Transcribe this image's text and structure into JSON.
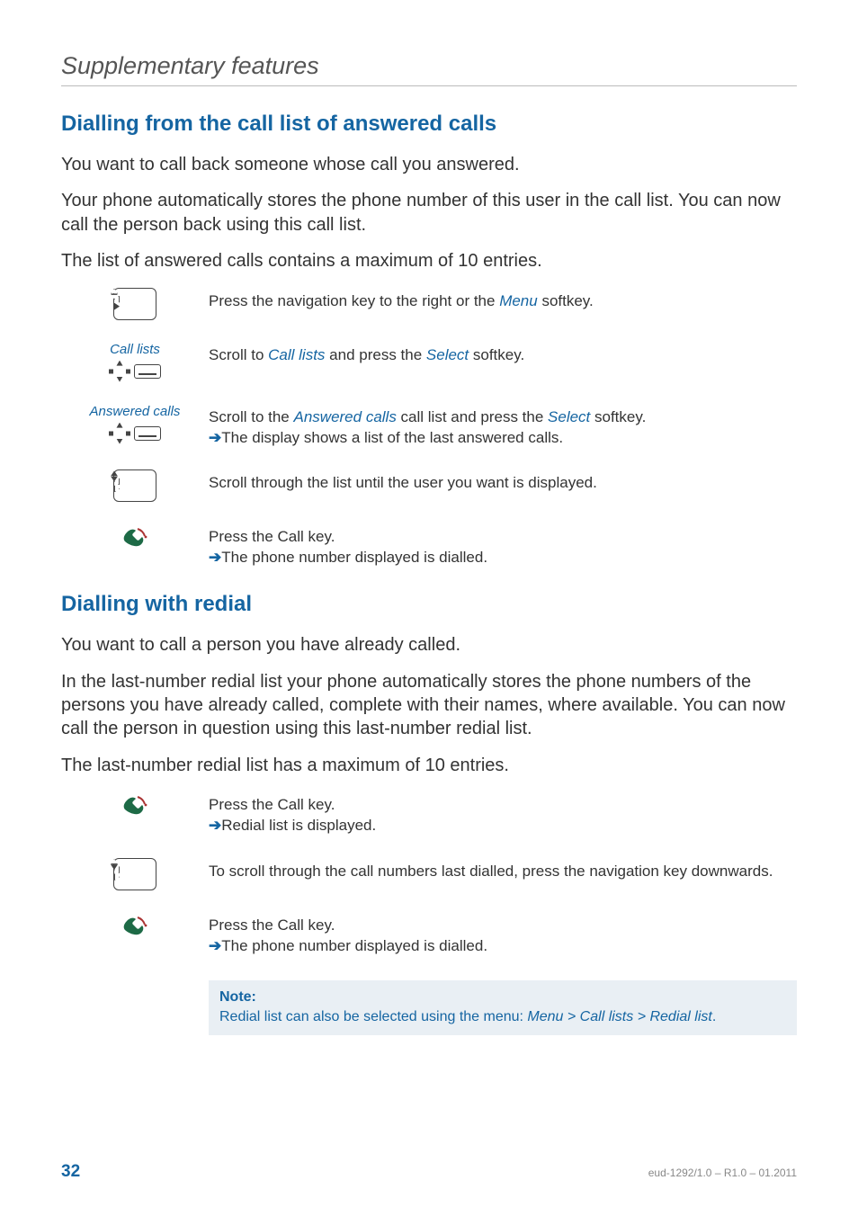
{
  "chapter_title": "Supplementary features",
  "section1": {
    "heading": "Dialling from the call list of answered calls",
    "p1": "You want to call back someone whose call you answered.",
    "p2": "Your phone automatically stores the phone number of this user in the call list. You can now call the person back using this call list.",
    "p3": "The list of answered calls contains a maximum of 10 entries.",
    "steps": [
      {
        "icon_label": "",
        "text_pre": "Press the navigation key to the right or the ",
        "term1": "Menu",
        "text_post": " softkey."
      },
      {
        "icon_label": "Call lists",
        "text_pre": "Scroll to ",
        "term1": "Call lists",
        "text_mid": " and press the ",
        "term2": "Select",
        "text_post": " softkey."
      },
      {
        "icon_label": "Answered calls",
        "text_pre": "Scroll to the ",
        "term1": "Answered calls",
        "text_mid": " call list and press the ",
        "term2": "Select",
        "text_post": " softkey.",
        "arrow_text": "The display shows a list of the last answered calls."
      },
      {
        "icon_label": "",
        "text_pre": "Scroll through the list until the user you want is displayed."
      },
      {
        "icon_label": "",
        "text_pre": "Press the Call key.",
        "arrow_text": "The phone number displayed is dialled."
      }
    ]
  },
  "section2": {
    "heading": "Dialling with redial",
    "p1": "You want to call a person you have already called.",
    "p2": "In the last-number redial list your phone automatically stores the phone numbers of the persons you have already called, complete with their names, where available. You can now call the person in question using this last-number redial list.",
    "p3": "The last-number redial list has a maximum of 10 entries.",
    "steps": [
      {
        "text_pre": "Press the Call key.",
        "arrow_text": "Redial list is displayed."
      },
      {
        "text_pre": "To scroll through the call numbers last dialled, press the navigation key downwards."
      },
      {
        "text_pre": "Press the Call key.",
        "arrow_text": "The phone number displayed is dialled."
      }
    ],
    "note": {
      "label": "Note:",
      "pre": "Redial list can also be selected using the menu: ",
      "path": "Menu > Call lists > Redial list",
      "post": "."
    }
  },
  "footer": {
    "page": "32",
    "docid": "eud-1292/1.0 – R1.0 – 01.2011"
  }
}
